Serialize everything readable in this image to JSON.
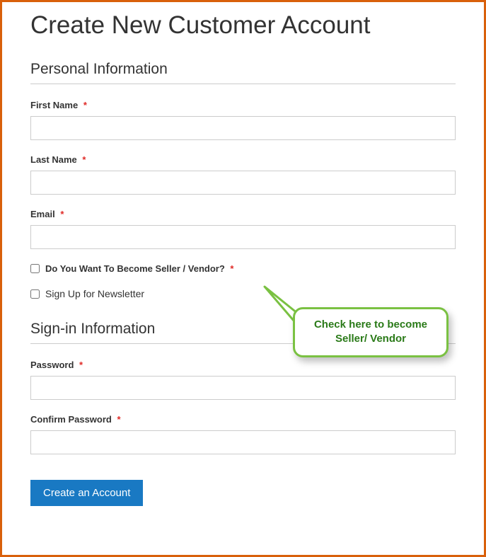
{
  "page": {
    "title": "Create New Customer Account"
  },
  "sections": {
    "personal": {
      "title": "Personal Information",
      "first_name_label": "First Name",
      "last_name_label": "Last Name",
      "email_label": "Email",
      "become_seller_label": "Do You Want To Become Seller / Vendor?",
      "newsletter_label": "Sign Up for Newsletter"
    },
    "signin": {
      "title": "Sign-in Information",
      "password_label": "Password",
      "confirm_password_label": "Confirm Password"
    }
  },
  "button": {
    "submit_label": "Create an Account"
  },
  "callout": {
    "text": "Check here to become Seller/ Vendor"
  },
  "required_marker": "*"
}
